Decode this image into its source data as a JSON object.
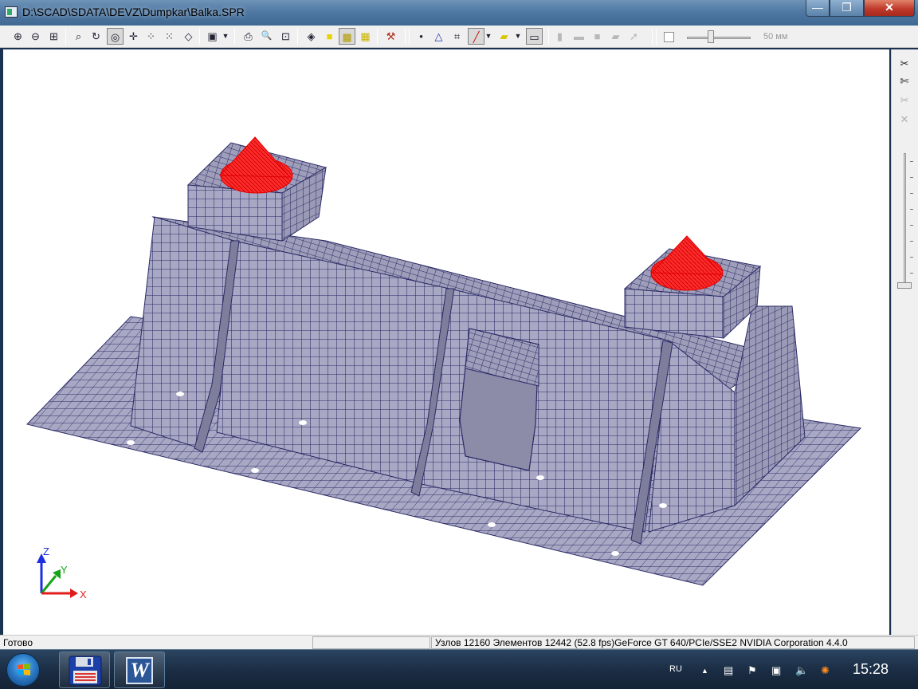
{
  "window": {
    "title": "D:\\SCAD\\SDATA\\DEVZ\\Dumpkar\\Balka.SPR",
    "minimize": "—",
    "maximize": "❐",
    "close": "✕"
  },
  "toolbar": {
    "icons": [
      {
        "name": "zoom-in-icon",
        "glyph": "⊕"
      },
      {
        "name": "zoom-out-icon",
        "glyph": "⊖"
      },
      {
        "name": "zoom-window-icon",
        "glyph": "⊞"
      },
      {
        "name": "zoom-all-icon",
        "glyph": "⌕"
      },
      {
        "name": "rotate-icon",
        "glyph": "↻"
      },
      {
        "name": "pan-icon",
        "glyph": "◎"
      },
      {
        "name": "center-icon",
        "glyph": "✛"
      },
      {
        "name": "fragment-icon",
        "glyph": "⁘"
      },
      {
        "name": "restore-fragment-icon",
        "glyph": "⁙"
      },
      {
        "name": "projection-icon",
        "glyph": "◇"
      },
      {
        "name": "view-cube-icon",
        "glyph": "▣"
      },
      {
        "name": "print-icon",
        "glyph": "⎙"
      },
      {
        "name": "preview-icon",
        "glyph": "🔍"
      },
      {
        "name": "export-icon",
        "glyph": "⊡"
      },
      {
        "name": "wireframe-icon",
        "glyph": "◈"
      },
      {
        "name": "solid-yellow-icon",
        "glyph": "■"
      },
      {
        "name": "solid-shaded-icon",
        "glyph": "▩"
      },
      {
        "name": "solid-cube-icon",
        "glyph": "▦"
      },
      {
        "name": "settings-hammer-icon",
        "glyph": "⚒"
      },
      {
        "name": "nodes-icon",
        "glyph": "•"
      },
      {
        "name": "supports-icon",
        "glyph": "△"
      },
      {
        "name": "grid-icon",
        "glyph": "⌗"
      },
      {
        "name": "bars-icon",
        "glyph": "╱"
      },
      {
        "name": "plates-icon",
        "glyph": "▰"
      },
      {
        "name": "shrink-icon",
        "glyph": "▭"
      },
      {
        "name": "filter1-icon",
        "glyph": "▮"
      },
      {
        "name": "filter2-icon",
        "glyph": "▬"
      },
      {
        "name": "filter3-icon",
        "glyph": "■"
      },
      {
        "name": "filter4-icon",
        "glyph": "▰"
      },
      {
        "name": "filter5-icon",
        "glyph": "➚"
      }
    ],
    "thickness_label": "50 мм"
  },
  "right_tools": [
    {
      "name": "cut-icon",
      "glyph": "✂"
    },
    {
      "name": "cut-nodes-icon",
      "glyph": "✄"
    },
    {
      "name": "cut-disabled-icon",
      "glyph": "✂"
    },
    {
      "name": "cut-x-icon",
      "glyph": "✕"
    }
  ],
  "axes": {
    "z": "Z",
    "y": "Y",
    "x": "X"
  },
  "status": {
    "left": "Готово",
    "right": "Узлов 12160  Элементов 12442  (52.8 fps)GeForce GT 640/PCIe/SSE2 NVIDIA Corporation 4.4.0"
  },
  "taskbar": {
    "apps": [
      {
        "name": "scad-taskbar-button",
        "icon": "floppy-icon"
      },
      {
        "name": "word-taskbar-button",
        "icon": "word-icon",
        "letter": "W"
      }
    ],
    "language": "RU",
    "clock": "15:28"
  },
  "colors": {
    "mesh_fill": "#a8a8c4",
    "mesh_dark": "#8e8eaa",
    "mesh_line": "#2a2a66",
    "load_red": "#ff1a1a",
    "axis_z": "#1c2ee0",
    "axis_y": "#17a317",
    "axis_x": "#e01c1c"
  }
}
